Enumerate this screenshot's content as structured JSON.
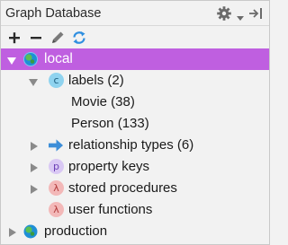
{
  "window": {
    "title": "Graph Database"
  },
  "toolbar": {
    "add_icon": "plus-icon",
    "remove_icon": "minus-icon",
    "edit_icon": "pencil-icon",
    "refresh_icon": "refresh-icon"
  },
  "colors": {
    "selection": "#bf5fe0",
    "label_badge": "#8fd3ef",
    "property_badge": "#d9c8f4",
    "procedure_badge": "#f3b8b8",
    "relationship_arrow": "#3d8ed8"
  },
  "tree": {
    "root": {
      "label": "local",
      "expanded": true,
      "selected": true
    },
    "labels": {
      "label": "labels (2)",
      "badge": "c",
      "expanded": true
    },
    "label_items": [
      {
        "label": "Movie (38)"
      },
      {
        "label": "Person (133)"
      }
    ],
    "relationship_types": {
      "label": "relationship types (6)"
    },
    "property_keys": {
      "label": "property keys",
      "badge": "p"
    },
    "stored_procedures": {
      "label": "stored procedures",
      "badge": "λ"
    },
    "user_functions": {
      "label": "user functions",
      "badge": "λ"
    },
    "production": {
      "label": "production",
      "expanded": false
    }
  }
}
